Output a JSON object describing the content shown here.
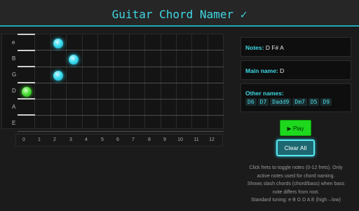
{
  "app": {
    "title": "Guitar Chord Namer ✓"
  },
  "fretboard": {
    "strings": [
      "e",
      "B",
      "G",
      "D",
      "A",
      "E"
    ],
    "fret_numbers": [
      "0",
      "1",
      "2",
      "3",
      "4",
      "5",
      "6",
      "7",
      "8",
      "9",
      "10",
      "11",
      "12"
    ],
    "active_notes": [
      {
        "string": "e",
        "fret": 2,
        "role": "note"
      },
      {
        "string": "B",
        "fret": 3,
        "role": "note"
      },
      {
        "string": "G",
        "fret": 2,
        "role": "note"
      },
      {
        "string": "D",
        "fret": 0,
        "role": "root"
      }
    ]
  },
  "results": {
    "notes_label": "Notes:",
    "notes_value": "D F# A",
    "main_label": "Main name:",
    "main_value": "D",
    "other_label": "Other names:",
    "other_names": [
      "D6",
      "D7",
      "Dadd9",
      "Dm7",
      "D5",
      "D9"
    ]
  },
  "controls": {
    "play_label": "▶ Play",
    "clear_label": "Clear All"
  },
  "help": {
    "line1": "Click frets to toggle notes (0-12 frets). Only",
    "line2": "active notes used for chord naming.",
    "line3": "Shows slash chords (chord/bass) when bass",
    "line4": "note differs from root.",
    "line5": "Standard tuning: e B G D A E (high→low)"
  },
  "colors": {
    "accent": "#3fd8e4",
    "root_note": "#4fe33a",
    "play_button": "#1ed81e"
  }
}
